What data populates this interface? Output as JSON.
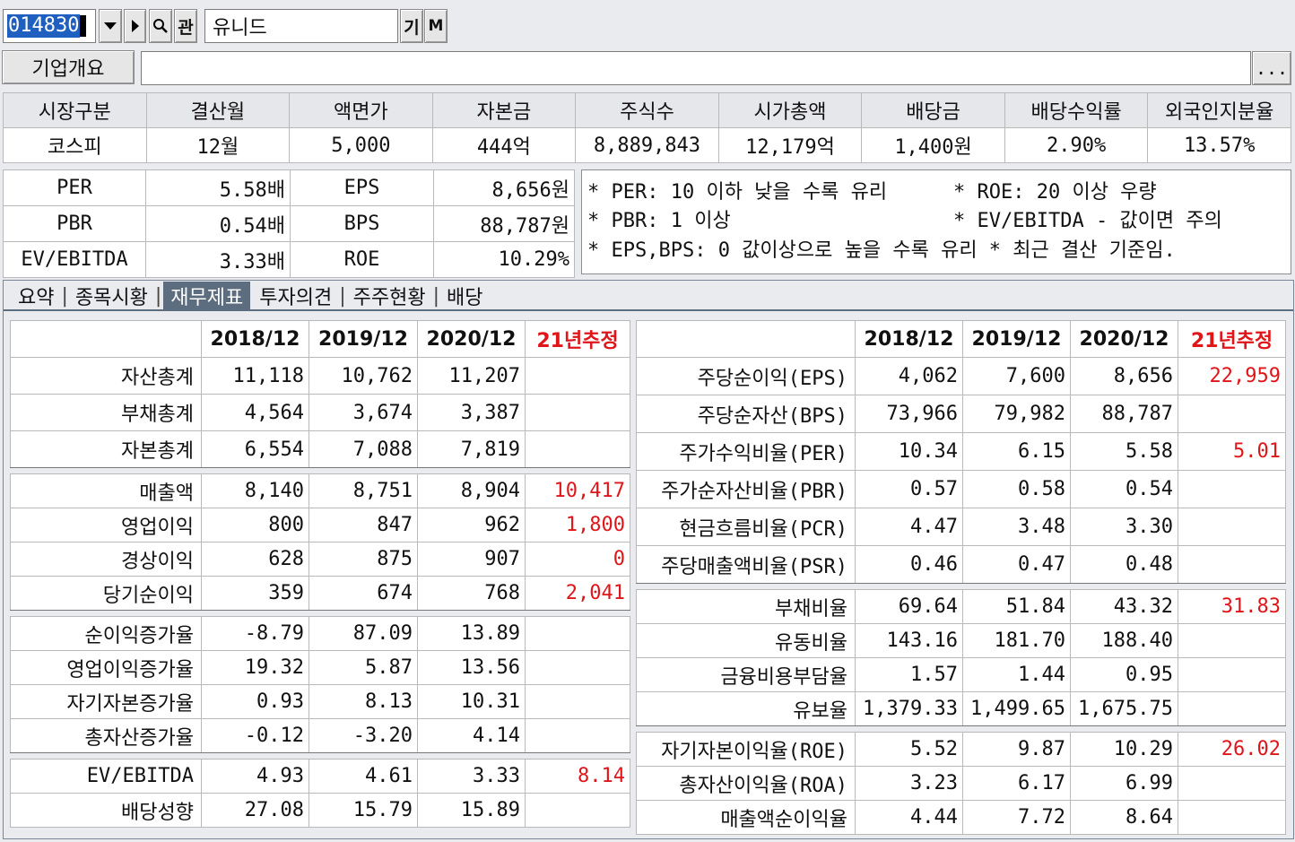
{
  "toolbar": {
    "code": "014830",
    "name": "유니드",
    "search_icon": "search-icon",
    "gwan_label": "관",
    "gi_label": "기",
    "m_label": "M"
  },
  "company": {
    "overview_button": "기업개요",
    "overview_text": "",
    "more_button": "..."
  },
  "info": {
    "headers": [
      "시장구분",
      "결산월",
      "액면가",
      "자본금",
      "주식수",
      "시가총액",
      "배당금",
      "배당수익률",
      "외국인지분율"
    ],
    "values": [
      "코스피",
      "12월",
      "5,000",
      "444억",
      "8,889,843",
      "12,179억",
      "1,400원",
      "2.90%",
      "13.57%"
    ]
  },
  "ratios": {
    "rows": [
      [
        "PER",
        "5.58배",
        "EPS",
        "8,656원"
      ],
      [
        "PBR",
        "0.54배",
        "BPS",
        "88,787원"
      ],
      [
        "EV/EBITDA",
        "3.33배",
        "ROE",
        "10.29%"
      ]
    ]
  },
  "notes": {
    "line1a": "* PER: 10 이하 낮을 수록 유리",
    "line1b": "* ROE: 20 이상 우량",
    "line2a": "* PBR: 1 이상",
    "line2b": "* EV/EBITDA - 값이면 주의",
    "line3": "* EPS,BPS: 0 값이상으로 높을 수록 유리 * 최근 결산 기준임."
  },
  "tabs": {
    "items": [
      "요약",
      "종목시황",
      "재무제표",
      "투자의견",
      "주주현황",
      "배당"
    ],
    "active": "재무제표"
  },
  "financials": {
    "columns": [
      "2018/12",
      "2019/12",
      "2020/12",
      "21년추정"
    ],
    "left_groups": [
      [
        [
          "자산총계",
          "11,118",
          "10,762",
          "11,207",
          ""
        ],
        [
          "부채총계",
          "4,564",
          "3,674",
          "3,387",
          ""
        ],
        [
          "자본총계",
          "6,554",
          "7,088",
          "7,819",
          ""
        ]
      ],
      [
        [
          "매출액",
          "8,140",
          "8,751",
          "8,904",
          "10,417"
        ],
        [
          "영업이익",
          "800",
          "847",
          "962",
          "1,800"
        ],
        [
          "경상이익",
          "628",
          "875",
          "907",
          "0"
        ],
        [
          "당기순이익",
          "359",
          "674",
          "768",
          "2,041"
        ]
      ],
      [
        [
          "순이익증가율",
          "-8.79",
          "87.09",
          "13.89",
          ""
        ],
        [
          "영업이익증가율",
          "19.32",
          "5.87",
          "13.56",
          ""
        ],
        [
          "자기자본증가율",
          "0.93",
          "8.13",
          "10.31",
          ""
        ],
        [
          "총자산증가율",
          "-0.12",
          "-3.20",
          "4.14",
          ""
        ]
      ],
      [
        [
          "EV/EBITDA",
          "4.93",
          "4.61",
          "3.33",
          "8.14"
        ],
        [
          "배당성향",
          "27.08",
          "15.79",
          "15.89",
          ""
        ]
      ]
    ],
    "right_groups": [
      [
        [
          "주당순이익(EPS)",
          "4,062",
          "7,600",
          "8,656",
          "22,959"
        ],
        [
          "주당순자산(BPS)",
          "73,966",
          "79,982",
          "88,787",
          ""
        ],
        [
          "주가수익비율(PER)",
          "10.34",
          "6.15",
          "5.58",
          "5.01"
        ],
        [
          "주가순자산비율(PBR)",
          "0.57",
          "0.58",
          "0.54",
          ""
        ],
        [
          "현금흐름비율(PCR)",
          "4.47",
          "3.48",
          "3.30",
          ""
        ],
        [
          "주당매출액비율(PSR)",
          "0.46",
          "0.47",
          "0.48",
          ""
        ]
      ],
      [
        [
          "부채비율",
          "69.64",
          "51.84",
          "43.32",
          "31.83"
        ],
        [
          "유동비율",
          "143.16",
          "181.70",
          "188.40",
          ""
        ],
        [
          "금융비용부담율",
          "1.57",
          "1.44",
          "0.95",
          ""
        ],
        [
          "유보율",
          "1,379.33",
          "1,499.65",
          "1,675.75",
          ""
        ]
      ],
      [
        [
          "자기자본이익율(ROE)",
          "5.52",
          "9.87",
          "10.29",
          "26.02"
        ],
        [
          "총자산이익율(ROA)",
          "3.23",
          "6.17",
          "6.99",
          ""
        ],
        [
          "매출액순이익율",
          "4.44",
          "7.72",
          "8.64",
          ""
        ]
      ]
    ]
  },
  "colors": {
    "estimate": "#e0151a",
    "active_tab": "#5d6d80",
    "code_highlight": "#1f5fbf"
  }
}
